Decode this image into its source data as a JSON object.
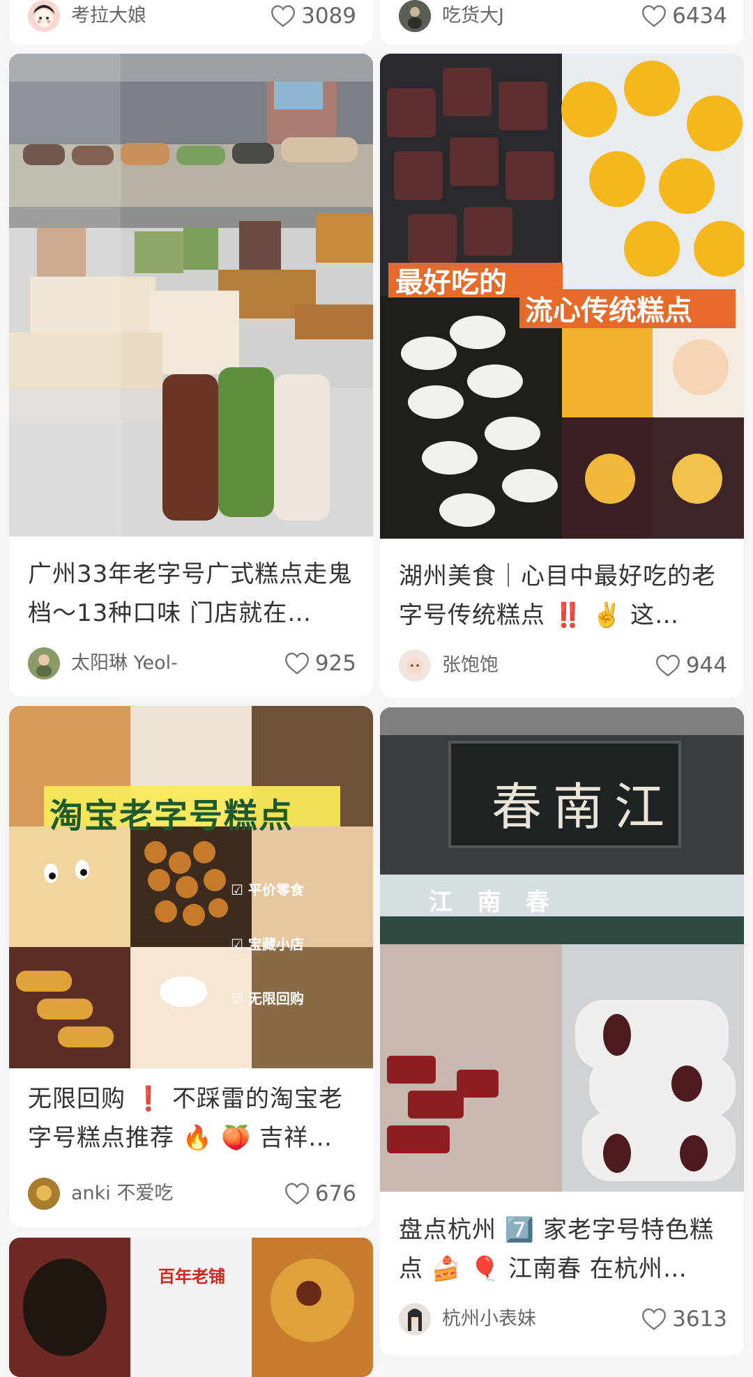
{
  "cards": {
    "top_left": {
      "author": "考拉大娘",
      "likes": "3089"
    },
    "top_right": {
      "author": "吃货大J",
      "likes": "6434"
    },
    "card1": {
      "title": "广州33年老字号广式糕点走鬼档～13种口味 门店就在…",
      "author": "太阳琳 Yeol-",
      "likes": "925"
    },
    "card2": {
      "title": "湖州美食｜心目中最好吃的老字号传统糕点 ‼️ ✌️ 这…",
      "author": "张饱饱",
      "likes": "944",
      "overlay_line1": "最好吃的",
      "overlay_line2": "流心传统糕点"
    },
    "card3": {
      "title": "无限回购 ❗ 不踩雷的淘宝老字号糕点推荐 🔥 🍑 吉祥…",
      "author": "anki 不爱吃",
      "likes": "676",
      "overlay_banner": "淘宝老字号糕点",
      "check1": "平价零食",
      "check2": "宝藏小店",
      "check3": "无限回购"
    },
    "card4": {
      "title": "盘点杭州 7️⃣ 家老字号特色糕点 🍰 🎈 江南春 在杭州…",
      "author": "杭州小表妹",
      "likes": "3613",
      "sign_text": "春南江",
      "awning_text": "江   南   春"
    },
    "card5": {
      "sticker_text": "百年老铺"
    }
  }
}
